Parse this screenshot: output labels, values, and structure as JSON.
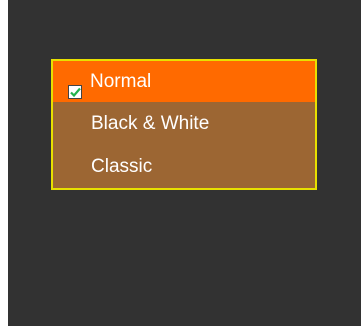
{
  "menu": {
    "items": [
      {
        "label": "Normal",
        "selected": true,
        "icon": "check-icon"
      },
      {
        "label": "Black & White",
        "selected": false
      },
      {
        "label": "Classic",
        "selected": false
      }
    ]
  },
  "colors": {
    "screen_bg": "#323232",
    "menu_bg": "#9c6633",
    "menu_border": "#e8e000",
    "selected_bg": "#ff6a00",
    "text": "#ffffff",
    "check_mark": "#22b24c"
  }
}
